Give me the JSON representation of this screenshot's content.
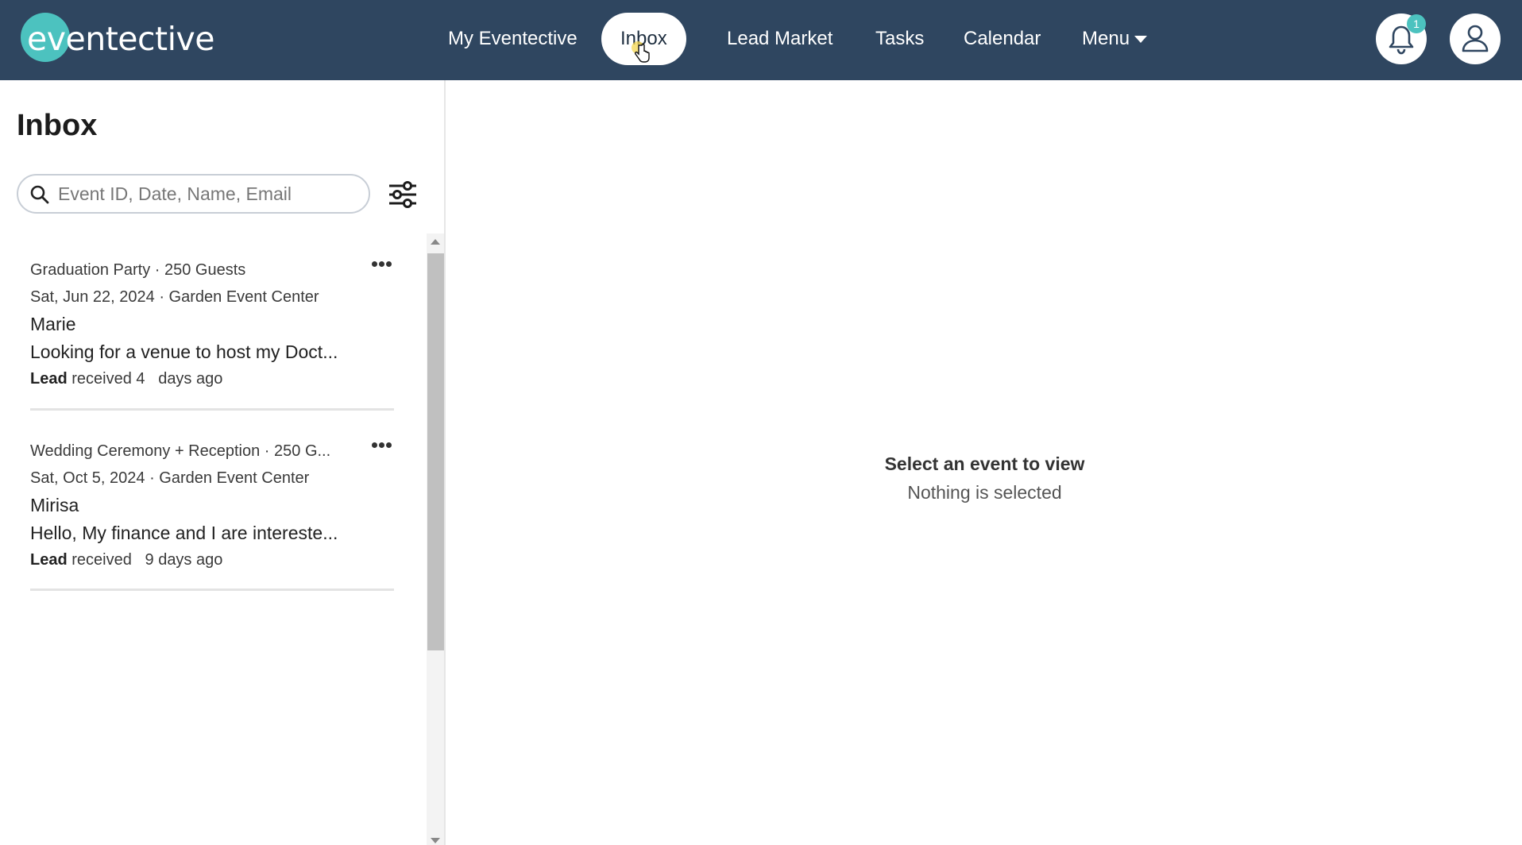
{
  "app": {
    "logo_text": "eventective",
    "brand_color": "#2f4660",
    "accent_color": "#4cc2bf"
  },
  "nav": {
    "items": [
      {
        "label": "My Eventective"
      },
      {
        "label": "Inbox",
        "active": true
      },
      {
        "label": "Lead Market"
      },
      {
        "label": "Tasks"
      },
      {
        "label": "Calendar"
      },
      {
        "label": "Menu"
      }
    ]
  },
  "notifications": {
    "count": "1",
    "icon": "bell-icon"
  },
  "account": {
    "icon": "user-icon"
  },
  "sidebar": {
    "title": "Inbox",
    "search": {
      "placeholder": "Event ID, Date, Name, Email",
      "value": ""
    },
    "filter_icon": "sliders-icon"
  },
  "leads": [
    {
      "event": "Graduation Party · 250 Guests",
      "date_venue": "Sat, Jun 22, 2024 · Garden Event Center",
      "name": "Marie",
      "preview": "Looking for a venue to host my Doct...",
      "status_bold": "Lead",
      "status_rest": " received 4   days ago"
    },
    {
      "event": "Wedding Ceremony + Reception · 250 G...",
      "date_venue": "Sat, Oct 5, 2024 · Garden Event Center",
      "name": "Mirisa",
      "preview": "Hello, My finance and I are intereste...",
      "status_bold": "Lead",
      "status_rest": " received   9 days ago"
    }
  ],
  "detail": {
    "empty_title": "Select an event to view",
    "empty_subtitle": "Nothing is selected"
  }
}
